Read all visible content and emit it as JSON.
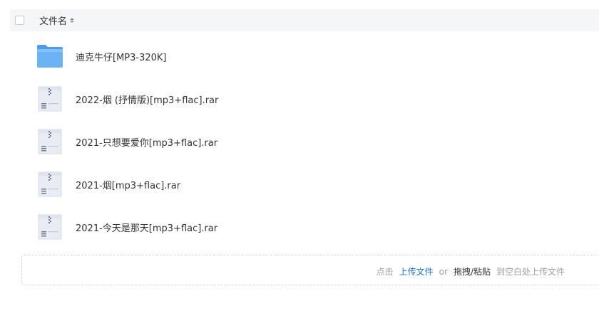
{
  "header": {
    "select_all": false,
    "column_label": "文件名"
  },
  "files": [
    {
      "name": "迪克牛仔[MP3-320K]",
      "icon": "folder-icon"
    },
    {
      "name": "2022-烟 (抒情版)[mp3+flac].rar",
      "icon": "archive-file-icon"
    },
    {
      "name": "2021-只想要爱你[mp3+flac].rar",
      "icon": "archive-file-icon"
    },
    {
      "name": "2021-烟[mp3+flac].rar",
      "icon": "archive-file-icon"
    },
    {
      "name": "2021-今天是那天[mp3+flac].rar",
      "icon": "archive-file-icon"
    }
  ],
  "upload": {
    "prefix": "点击",
    "upload_link": "上传文件",
    "or": "or",
    "drag_paste": "拖拽/粘贴",
    "suffix": "到空白处上传文件"
  },
  "colors": {
    "header_bg": "#f5f6f7",
    "link": "#1a73d9",
    "folder": "#5aa9f0"
  }
}
